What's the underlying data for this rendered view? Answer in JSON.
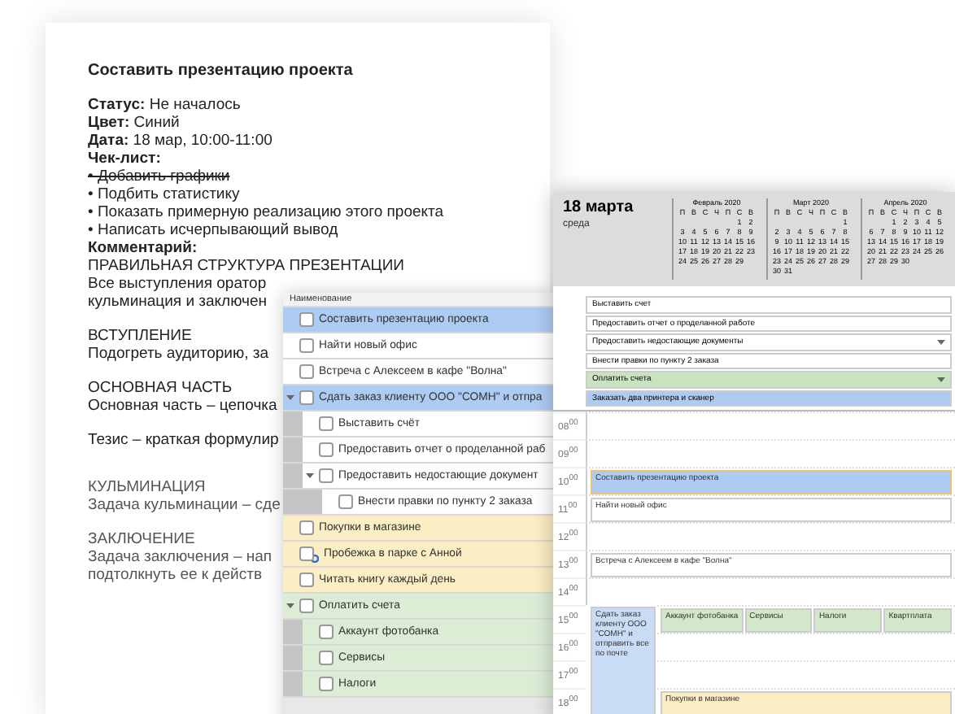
{
  "note": {
    "title": "Составить презентацию проекта",
    "fields": [
      "**Статус:** Не началось",
      "**Цвет:** Синий",
      "**Дата:** 18 мар, 10:00-11:00"
    ],
    "checklist_label": "Чек-лист:",
    "checklist": [
      {
        "text": "• Добавить графики",
        "done": true
      },
      {
        "text": "• Подбить статистику",
        "done": false
      },
      {
        "text": "• Показать примерную реализацию этого проекта",
        "done": false
      },
      {
        "text": "• Написать исчерпывающий вывод",
        "done": false
      }
    ],
    "comment_label": "Комментарий:",
    "comment": [
      {
        "heading": "ПРАВИЛЬНАЯ СТРУКТУРА ПРЕЗЕНТАЦИИ",
        "lines": [
          "Все выступления оратор",
          "кульминация и заключен"
        ]
      },
      {
        "heading": "ВСТУПЛЕНИЕ",
        "lines": [
          "Подогреть аудиторию, за"
        ]
      },
      {
        "heading": "ОСНОВНАЯ ЧАСТЬ",
        "lines": [
          "Основная часть – цепочка"
        ]
      },
      {
        "lines": [
          "Тезис – краткая формулир"
        ]
      },
      {
        "heading": "КУЛЬМИНАЦИЯ",
        "lines": [
          "Задача кульминации – сде"
        ]
      },
      {
        "heading": "ЗАКЛЮЧЕНИЕ",
        "lines": [
          "Задача заключения – нап",
          "подтолкнуть ее к действ"
        ]
      }
    ]
  },
  "task_list": {
    "column": "Наименование",
    "items": [
      {
        "text": "Составить презентацию проекта",
        "color": "#aecbf2",
        "checked": false
      },
      {
        "text": "Найти новый офис",
        "color": "#ffffff",
        "checked": false
      },
      {
        "text": "Встреча с Алексеем в кафе \"Волна\"",
        "color": "#ffffff",
        "checked": false
      },
      {
        "text": "Сдать заказ клиенту ООО \"СОМН\" и отпра",
        "color": "#aecbf2",
        "checked": false,
        "expanded": true,
        "children": [
          {
            "text": "Выставить счёт",
            "color": "#ffffff",
            "checked": false
          },
          {
            "text": "Предоставить отчет о проделанной раб",
            "color": "#ffffff",
            "checked": false
          },
          {
            "text": "Предоставить недостающие документ",
            "color": "#ffffff",
            "checked": false,
            "expanded": true,
            "children": [
              {
                "text": "Внести правки по пункту 2 заказа",
                "color": "#ffffff",
                "checked": false
              }
            ]
          }
        ]
      },
      {
        "text": "Покупки в магазине",
        "color": "#fbeec4",
        "checked": false
      },
      {
        "text": "Пробежка в парке с Анной",
        "color": "#fbeec4",
        "checked": false,
        "recurring": true
      },
      {
        "text": "Читать книгу каждый день",
        "color": "#fbeec4",
        "checked": false
      },
      {
        "text": "Оплатить счета",
        "color": "#dcedd6",
        "checked": false,
        "expanded": true,
        "children": [
          {
            "text": "Аккаунт фотобанка",
            "color": "#dcedd6",
            "checked": false
          },
          {
            "text": "Сервисы",
            "color": "#dcedd6",
            "checked": false
          },
          {
            "text": "Налоги",
            "color": "#dcedd6",
            "checked": false
          }
        ]
      }
    ]
  },
  "calendar": {
    "date": "18 марта",
    "weekday": "среда",
    "months": [
      {
        "title": "Февраль 2020",
        "weekdays": [
          "П",
          "В",
          "С",
          "Ч",
          "П",
          "С",
          "В"
        ],
        "weeks": [
          [
            "1",
            "2"
          ],
          [
            "3",
            "4",
            "5",
            "6",
            "7",
            "8",
            "9"
          ],
          [
            "10",
            "11",
            "12",
            "13",
            "14",
            "15",
            "16"
          ],
          [
            "17",
            "18",
            "19",
            "20",
            "21",
            "22",
            "23"
          ],
          [
            "24",
            "25",
            "26",
            "27",
            "28",
            "29"
          ]
        ]
      },
      {
        "title": "Март 2020",
        "weekdays": [
          "П",
          "В",
          "С",
          "Ч",
          "П",
          "С",
          "В"
        ],
        "weeks": [
          [
            "1"
          ],
          [
            "2",
            "3",
            "4",
            "5",
            "6",
            "7",
            "8"
          ],
          [
            "9",
            "10",
            "11",
            "12",
            "13",
            "14",
            "15"
          ],
          [
            "16",
            "17",
            "18",
            "19",
            "20",
            "21",
            "22"
          ],
          [
            "23",
            "24",
            "25",
            "26",
            "27",
            "28",
            "29"
          ],
          [
            "30",
            "31"
          ]
        ]
      },
      {
        "title": "Апрель 2020",
        "weekdays": [
          "П",
          "В",
          "С",
          "Ч",
          "П",
          "С",
          "В"
        ],
        "weeks": [
          [
            "1",
            "2",
            "3",
            "4",
            "5"
          ],
          [
            "6",
            "7",
            "8",
            "9",
            "10",
            "11",
            "12"
          ],
          [
            "13",
            "14",
            "15",
            "16",
            "17",
            "18",
            "19"
          ],
          [
            "20",
            "21",
            "22",
            "23",
            "24",
            "25",
            "26"
          ],
          [
            "27",
            "28",
            "29",
            "30"
          ]
        ]
      }
    ],
    "all_day": [
      {
        "text": "Выставить счет",
        "color": "#ffffff"
      },
      {
        "text": "Предоставить отчет о проделанной работе",
        "color": "#ffffff"
      },
      {
        "text": "Предоставить недостающие документы",
        "color": "#ffffff",
        "expandable": true
      },
      {
        "text": "Внести правки по пункту 2 заказа",
        "color": "#ffffff"
      },
      {
        "text": "Оплатить счета",
        "color": "#c9e3c0",
        "expandable": true
      },
      {
        "text": "Заказать два принтера и сканер",
        "color": "#aecbf2"
      }
    ],
    "hours": [
      {
        "label": "08$^{00}$"
      },
      {
        "label": "09$^{00}$"
      },
      {
        "label": "10$^{00}$",
        "events": [
          {
            "text": "Составить презентацию проекта",
            "color": "#aecbf2",
            "selected": true
          }
        ]
      },
      {
        "label": "11$^{00}$",
        "events": [
          {
            "text": "Найти новый офис",
            "color": "#ffffff",
            "selected": false
          }
        ]
      },
      {
        "label": "12$^{00}$"
      },
      {
        "label": "13$^{00}$",
        "events": [
          {
            "text": "Встреча с Алексеем в кафе \"Волна\"",
            "color": "#ffffff",
            "selected": false
          }
        ]
      },
      {
        "label": "14$^{00}$"
      },
      {
        "label": "15$^{00}$",
        "events": [
          {
            "text": "Сдать заказ клиенту ООО \"СОМН\" и отправить все по почте",
            "color": "#c9dcf6",
            "selected": false,
            "kind": "multi_hour"
          },
          {
            "text": "Аккаунт фотобанка",
            "color": "#d3e8cb",
            "selected": false
          },
          {
            "text": "Сервисы",
            "color": "#d3e8cb",
            "selected": false
          },
          {
            "text": "Налоги",
            "color": "#d3e8cb",
            "selected": false
          },
          {
            "text": "Квартплата",
            "color": "#d3e8cb",
            "selected": false
          }
        ]
      },
      {
        "label": "16$^{00}$"
      },
      {
        "label": "17$^{00}$"
      },
      {
        "label": "18$^{00}$",
        "events": [
          {
            "text": "Покупки в магазине",
            "color": "#fbeec4",
            "selected": false
          }
        ]
      }
    ]
  }
}
